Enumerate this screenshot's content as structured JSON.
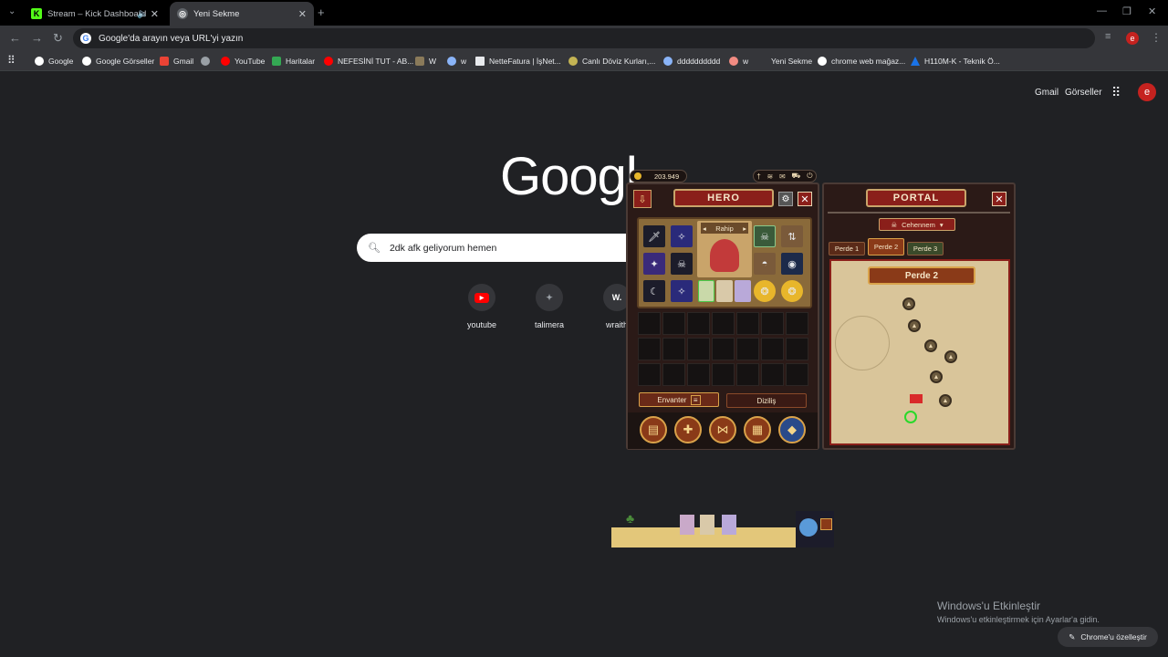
{
  "tabs": [
    {
      "title": "Stream – Kick Dashboard",
      "icon": "kick-icon",
      "audio_icon": "speaker-icon"
    },
    {
      "title": "Yeni Sekme",
      "icon": "chrome-icon"
    }
  ],
  "omnibox": {
    "placeholder": "Google'da arayın veya URL'yi yazın"
  },
  "profile_initial": "e",
  "bookmarks": [
    {
      "label": "Google",
      "icon": "google-icon"
    },
    {
      "label": "Google Görseller",
      "icon": "google-icon"
    },
    {
      "label": "Gmail",
      "icon": "gmail-icon"
    },
    {
      "label": "",
      "icon": "globe-icon"
    },
    {
      "label": "YouTube",
      "icon": "youtube-icon"
    },
    {
      "label": "Haritalar",
      "icon": "maps-icon"
    },
    {
      "label": "NEFESİNİ TUT - AB...",
      "icon": "youtube-icon"
    },
    {
      "label": "W",
      "icon": "site-icon"
    },
    {
      "label": "w",
      "icon": "site-icon"
    },
    {
      "label": "NetteFatura | İşNet...",
      "icon": "doc-icon"
    },
    {
      "label": "Canlı Döviz Kurları,...",
      "icon": "currency-icon"
    },
    {
      "label": "dddddddddd",
      "icon": "site-icon"
    },
    {
      "label": "w",
      "icon": "site-icon"
    },
    {
      "label": "Yeni Sekme",
      "icon": "blank-icon"
    },
    {
      "label": "chrome web mağaz...",
      "icon": "google-icon"
    },
    {
      "label": "H110M-K - Teknik Ö...",
      "icon": "asus-icon"
    }
  ],
  "ntp": {
    "gmail": "Gmail",
    "images": "Görseller",
    "logo": "Googl",
    "search_query": "2dk afk geliyorum hemen",
    "shortcuts": [
      {
        "label": "youtube",
        "glyph": "▶"
      },
      {
        "label": "talimera",
        "glyph": "✦"
      },
      {
        "label": "wraith",
        "glyph": "W."
      }
    ]
  },
  "game": {
    "coins": "203.949",
    "hero_title": "HERO",
    "hero_class": "Rahip",
    "inventory_tab": "Envanter",
    "formation_tab": "Diziliş",
    "portal_title": "PORTAL",
    "difficulty": "Cehennem",
    "acts": [
      "Perde 1",
      "Perde 2",
      "Perde 3"
    ],
    "map_title": "Perde 2",
    "inventory_rows": 3,
    "inventory_cols": 7
  },
  "watermark": {
    "title": "Windows'u Etkinleştir",
    "subtitle": "Windows'u etkinleştirmek için Ayarlar'a gidin."
  },
  "customize_label": "Chrome'u özelleştir"
}
